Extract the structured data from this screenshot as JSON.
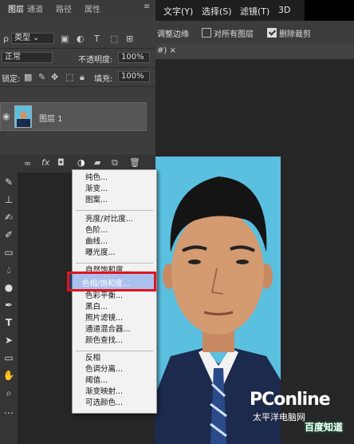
{
  "panel_tabs": [
    "图层",
    "通道",
    "路径",
    "属性"
  ],
  "menu": [
    "文字(Y)",
    "选择(S)",
    "滤镜(T)",
    "3D"
  ],
  "options": {
    "item1": "调整边缘",
    "item2": "对所有图层",
    "item3": "删除裁剪"
  },
  "doc_tab_suffix": "#) ×",
  "layers_panel": {
    "filter_label": "类型",
    "blend_mode": "正常",
    "opacity_label": "不透明度:",
    "opacity_value": "100%",
    "lock_label": "锁定:",
    "fill_label": "填充:",
    "fill_value": "100%",
    "layer_name": "图层 1",
    "fx_label": "fx"
  },
  "adjustment_menu": {
    "group1": [
      "纯色...",
      "渐变...",
      "图案..."
    ],
    "group2": [
      "亮度/对比度...",
      "色阶...",
      "曲线...",
      "曝光度..."
    ],
    "group3_top": "自然饱和度...",
    "highlighted": "色相/饱和度...",
    "group3_rest": [
      "色彩平衡...",
      "黑白...",
      "照片滤镜...",
      "通道混合器...",
      "颜色查找..."
    ],
    "group4": [
      "反相",
      "色调分离...",
      "阈值...",
      "渐变映射...",
      "可选颜色..."
    ]
  },
  "watermark": {
    "brand": "PConline",
    "cn": "太平洋电脑网",
    "baidu": "百度知道"
  },
  "colors": {
    "photo_bg": "#5bbfe0",
    "highlight_border": "#e0141e"
  }
}
